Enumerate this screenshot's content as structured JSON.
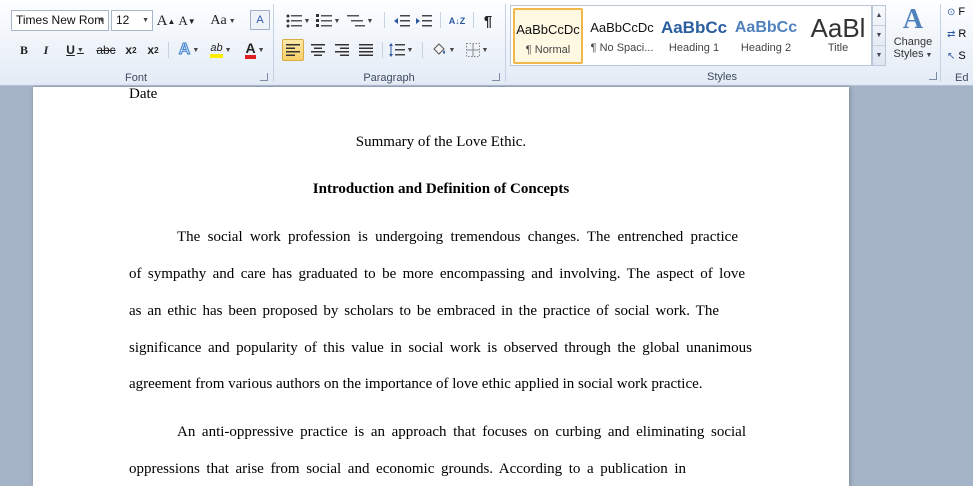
{
  "ribbon": {
    "font": {
      "group_label": "Font",
      "font_name": "Times New Rom",
      "font_size": "12",
      "grow_font": "A",
      "shrink_font": "A",
      "change_case": "Aa",
      "clear_format": "A",
      "bold": "B",
      "italic": "I",
      "underline": "U",
      "strikethrough": "abc",
      "subscript": "x",
      "subscript_mark": "2",
      "superscript": "x",
      "superscript_mark": "2",
      "text_effects": "A",
      "highlight": "ab",
      "font_color": "A",
      "highlight_color": "#ffee00",
      "font_color_value": "#e02020"
    },
    "paragraph": {
      "group_label": "Paragraph",
      "sort": "A↓Z",
      "pilcrow": "¶"
    },
    "styles": {
      "group_label": "Styles",
      "items": [
        {
          "preview": "AaBbCcDc",
          "label": "¶ Normal"
        },
        {
          "preview": "AaBbCcDc",
          "label": "¶ No Spaci..."
        },
        {
          "preview": "AaBbCc",
          "label": "Heading 1"
        },
        {
          "preview": "AaBbCc",
          "label": "Heading 2"
        },
        {
          "preview": "AaBl",
          "label": "Title"
        }
      ],
      "change_styles_icon": "A",
      "change_styles_line1": "Change",
      "change_styles_line2": "Styles",
      "heading_color": "#2a5d9f",
      "heading2_color": "#4f81bd"
    },
    "editing": {
      "group_label": "Ed",
      "find": "F",
      "replace": "R",
      "select": "S"
    }
  },
  "document": {
    "cut_line": "Date",
    "title": "Summary of the Love Ethic.",
    "heading": "Introduction and Definition of Concepts",
    "paragraph1": [
      "The social work profession is undergoing tremendous changes. The entrenched practice",
      "of sympathy and care has graduated to be more encompassing and involving. The aspect of love",
      "as an ethic has been proposed by scholars to be embraced in the practice of social work. The",
      "significance and popularity of this value in social work is observed through the global unanimous",
      "agreement from various authors on the importance of love ethic applied in social work practice."
    ],
    "paragraph2": [
      "An anti-oppressive practice is an approach that focuses on curbing and eliminating social",
      "oppressions that arise from social and economic grounds. According to a publication in"
    ]
  }
}
